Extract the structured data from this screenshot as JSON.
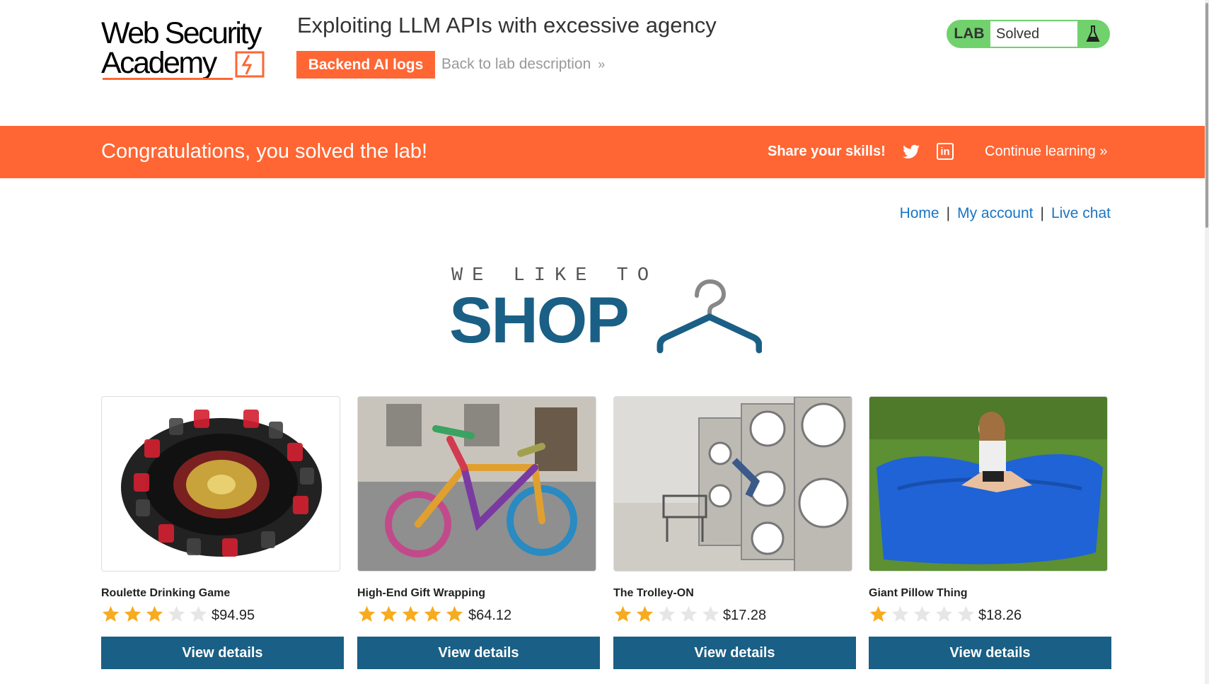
{
  "logo": {
    "line1": "Web Security",
    "line2": "Academy"
  },
  "lab": {
    "title": "Exploiting LLM APIs with excessive agency",
    "backend_button": "Backend AI logs",
    "back_link": "Back to lab description",
    "status_tag": "LAB",
    "status_value": "Solved"
  },
  "banner": {
    "message": "Congratulations, you solved the lab!",
    "share_label": "Share your skills!",
    "continue_label": "Continue learning",
    "linkedin_glyph": "in"
  },
  "nav": {
    "home": "Home",
    "account": "My account",
    "chat": "Live chat",
    "separator": "|"
  },
  "hero": {
    "small": "WE LIKE TO",
    "big": "SHOP"
  },
  "products": [
    {
      "name": "Roulette Drinking Game",
      "price": "$94.95",
      "rating": 3,
      "button": "View details"
    },
    {
      "name": "High-End Gift Wrapping",
      "price": "$64.12",
      "rating": 5,
      "button": "View details"
    },
    {
      "name": "The Trolley-ON",
      "price": "$17.28",
      "rating": 2,
      "button": "View details"
    },
    {
      "name": "Giant Pillow Thing",
      "price": "$18.26",
      "rating": 1,
      "button": "View details"
    }
  ],
  "colors": {
    "accent": "#ff6633",
    "primary": "#1a5f85",
    "link": "#1a75c2",
    "lab_solved": "#70d16d",
    "star_on": "#f7ab1e",
    "star_off": "#e6e6e6"
  },
  "icons": {
    "twitter": "twitter-icon",
    "linkedin": "linkedin-icon",
    "flask": "flask-icon",
    "hanger": "hanger-icon",
    "chevron": "double-chevron-icon",
    "star": "star-icon"
  }
}
